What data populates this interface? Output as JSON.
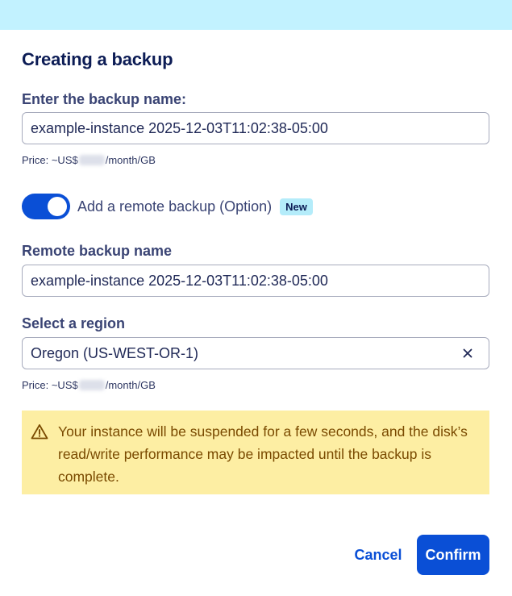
{
  "dialog": {
    "title": "Creating a backup",
    "backup_name": {
      "label": "Enter the backup name:",
      "value": "example-instance 2025-12-03T11:02:38-05:00"
    },
    "price1": {
      "prefix": "Price: ~US$",
      "suffix": "/month/GB"
    },
    "remote_backup": {
      "label": "Add a remote backup (Option)",
      "enabled": true,
      "badge": "New"
    },
    "remote_name": {
      "label": "Remote backup name",
      "value": "example-instance 2025-12-03T11:02:38-05:00"
    },
    "region": {
      "label": "Select a region",
      "value": "Oregon (US-WEST-OR-1)"
    },
    "price2": {
      "prefix": "Price: ~US$",
      "suffix": "/month/GB"
    },
    "warning": "Your instance will be suspended for a few seconds, and the disk’s read/write performance may be impacted until the backup is complete.",
    "buttons": {
      "cancel": "Cancel",
      "confirm": "Confirm"
    }
  },
  "icons": {
    "warning": "warning-triangle-icon",
    "clear": "close-icon"
  },
  "colors": {
    "top_band": "#c2f2ff",
    "primary": "#0a4fd6",
    "badge_bg": "#b4ecfa",
    "warning_bg": "#fdeea3",
    "warning_text": "#7a4a00",
    "heading": "#0c1c55"
  }
}
